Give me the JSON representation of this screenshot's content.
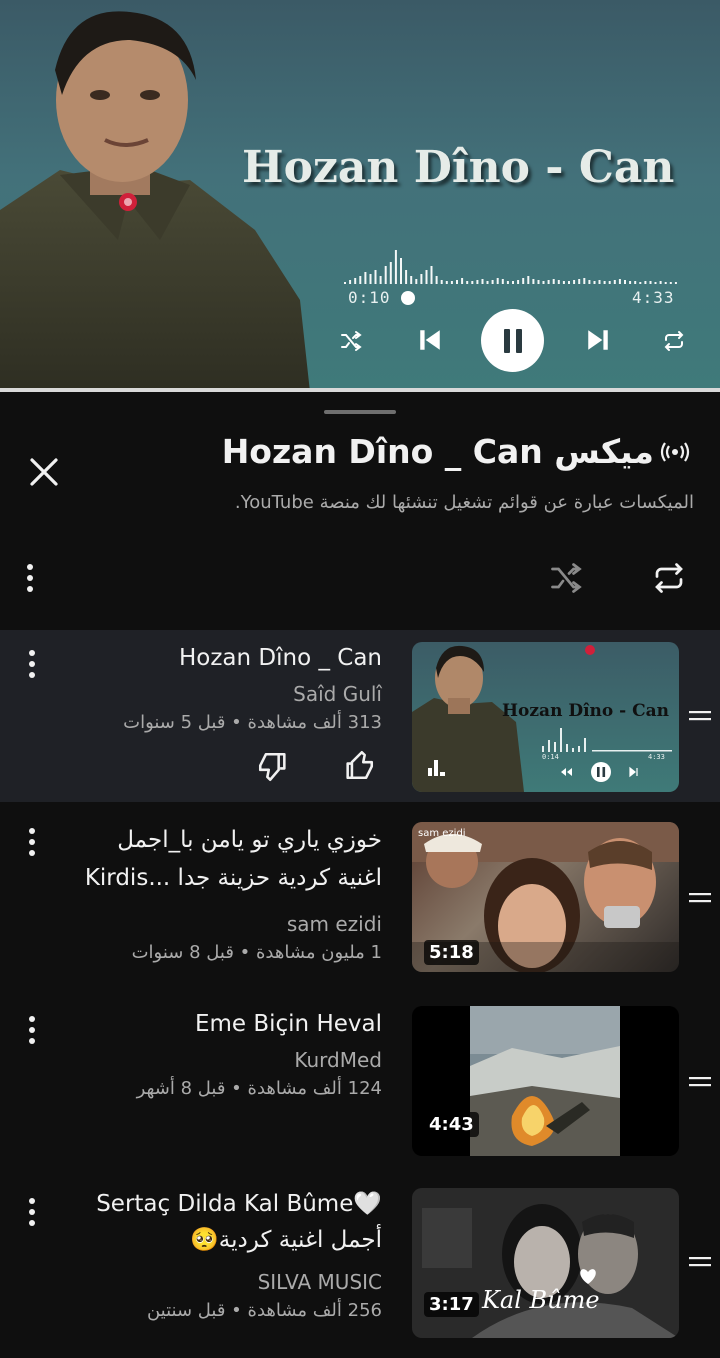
{
  "player": {
    "banner_text": "Hozan Dîno - Can",
    "time_current": "0:10",
    "time_total": "4:33",
    "progress_fraction": 0.037,
    "controls": [
      "shuffle-icon",
      "previous-icon",
      "pause-icon",
      "next-icon",
      "repeat-icon"
    ]
  },
  "panel": {
    "title": "Hozan Dîno _ Can ميكس",
    "title_icon": "radio-broadcast-icon",
    "description": "الميكسات عبارة عن قوائم تشغيل تنشئها لك منصة YouTube.",
    "close_icon": "close-icon"
  },
  "queue": [
    {
      "title_lines": [
        "Hozan Dîno _ Can"
      ],
      "channel": "Saîd Gulî",
      "meta": "313 ألف مشاهدة • قبل 5 سنوات",
      "duration": "",
      "active": true,
      "thumb_text": "Hozan Dîno - Can",
      "thumb_time_cur": "0:14",
      "thumb_time_tot": "4:33"
    },
    {
      "title_lines": [
        "خوزي ياري تو يامن با_اجمل",
        "اغنية كردية حزينة جدا ...Kirdis"
      ],
      "channel": "sam ezidi",
      "meta": "1 مليون مشاهدة • قبل 8 سنوات",
      "duration": "5:18",
      "thumb_watermark": "sam ezidi"
    },
    {
      "title_lines": [
        "Eme Biçin Heval"
      ],
      "channel": "KurdMed",
      "meta": "124 ألف مشاهدة • قبل 8 أشهر",
      "duration": "4:43"
    },
    {
      "title_lines": [
        "Sertaç Dilda Kal Bûme🤍",
        "أجمل اغنية كردية🥺"
      ],
      "channel": "SILVA MUSIC",
      "meta": "256 ألف مشاهدة • قبل سنتين",
      "duration": "3:17",
      "thumb_text": "Kal Bûme"
    }
  ],
  "colors": {
    "background": "#0f0f0f",
    "active_row": "#1f2126",
    "secondary_text": "#aaaaaa",
    "player_teal": "#43717a"
  }
}
